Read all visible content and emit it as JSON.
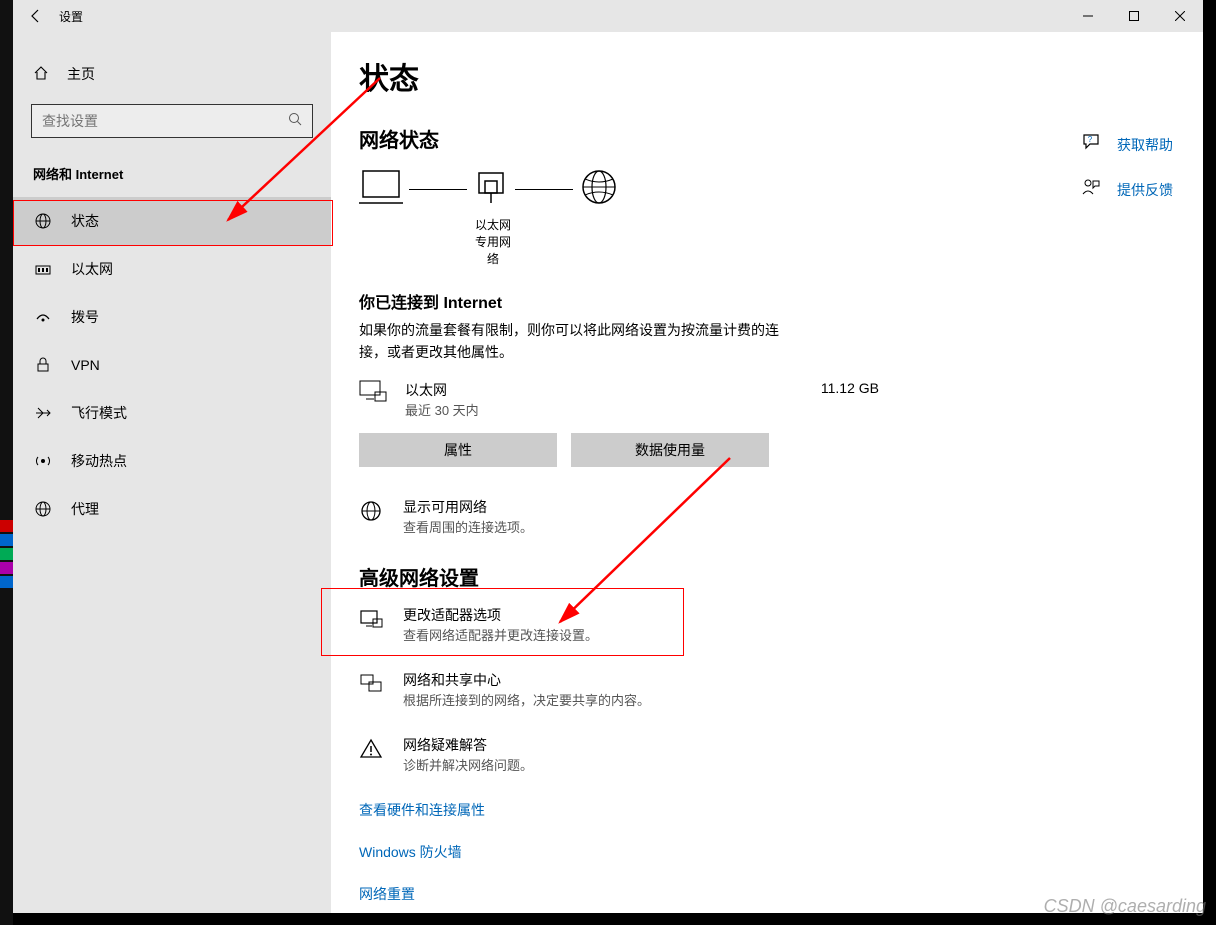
{
  "window": {
    "title": "设置"
  },
  "sidebar": {
    "home_label": "主页",
    "search_placeholder": "查找设置",
    "category": "网络和 Internet",
    "items": [
      {
        "icon": "globe-status-icon",
        "label": "状态",
        "selected": true
      },
      {
        "icon": "ethernet-icon",
        "label": "以太网"
      },
      {
        "icon": "dial-icon",
        "label": "拨号"
      },
      {
        "icon": "vpn-icon",
        "label": "VPN"
      },
      {
        "icon": "airplane-icon",
        "label": "飞行模式"
      },
      {
        "icon": "hotspot-icon",
        "label": "移动热点"
      },
      {
        "icon": "proxy-icon",
        "label": "代理"
      }
    ]
  },
  "main": {
    "page_title": "状态",
    "section_network_status": "网络状态",
    "diagram": {
      "ethernet_label": "以太网",
      "network_type": "专用网络"
    },
    "connected_heading": "你已连接到 Internet",
    "connected_desc": "如果你的流量套餐有限制，则你可以将此网络设置为按流量计费的连接，或者更改其他属性。",
    "usage": {
      "name": "以太网",
      "period": "最近 30 天内",
      "amount": "11.12 GB"
    },
    "btn_properties": "属性",
    "btn_data_usage": "数据使用量",
    "show_networks": {
      "title": "显示可用网络",
      "sub": "查看周围的连接选项。"
    },
    "section_advanced": "高级网络设置",
    "adapter_options": {
      "title": "更改适配器选项",
      "sub": "查看网络适配器并更改连接设置。"
    },
    "sharing_center": {
      "title": "网络和共享中心",
      "sub": "根据所连接到的网络，决定要共享的内容。"
    },
    "troubleshoot": {
      "title": "网络疑难解答",
      "sub": "诊断并解决网络问题。"
    },
    "link_hardware": "查看硬件和连接属性",
    "link_firewall": "Windows 防火墙",
    "link_reset": "网络重置"
  },
  "help": {
    "get_help": "获取帮助",
    "feedback": "提供反馈"
  },
  "watermark": "CSDN @caesarding"
}
